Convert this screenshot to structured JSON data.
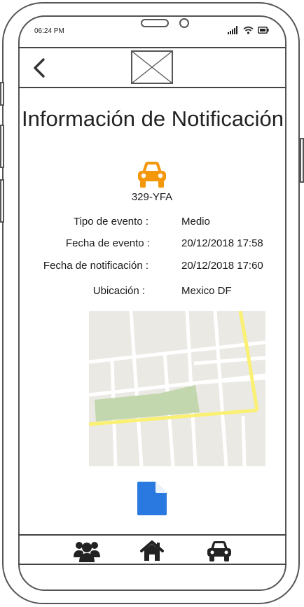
{
  "status_bar": {
    "time": "06:24 PM",
    "icons": [
      "signal-icon",
      "wifi-icon",
      "battery-icon"
    ]
  },
  "header": {
    "back_icon": "chevron-left-icon",
    "logo": "image-placeholder-icon"
  },
  "title": "Información de Notificación",
  "vehicle": {
    "icon": "car-icon",
    "plate": "329-YFA",
    "icon_color": "#f5970b"
  },
  "details": [
    {
      "label": "Tipo de evento :",
      "value": "Medio"
    },
    {
      "label": "Fecha de evento :",
      "value": "20/12/2018  17:58"
    },
    {
      "label": "Fecha de notificación :",
      "value": "20/12/2018  17:60"
    },
    {
      "label": "Ubicación :",
      "value": "Mexico DF"
    }
  ],
  "map": {
    "icon": "map-image"
  },
  "document": {
    "icon": "document-icon",
    "color": "#2a79e0"
  },
  "bottom_nav": [
    {
      "icon": "users-icon"
    },
    {
      "icon": "home-icon"
    },
    {
      "icon": "car-icon"
    }
  ]
}
